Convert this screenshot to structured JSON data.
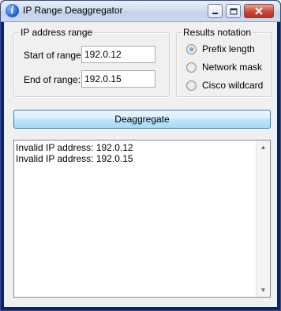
{
  "window": {
    "title": "IP Range Deaggregator",
    "icon": "info-icon"
  },
  "range_group": {
    "legend": "IP address range",
    "start_label": "Start of range:",
    "start_value": "192.0.12",
    "end_label": "End of range:",
    "end_value": "192.0.15"
  },
  "notation_group": {
    "legend": "Results notation",
    "options": [
      {
        "label": "Prefix length",
        "checked": true
      },
      {
        "label": "Network mask",
        "checked": false
      },
      {
        "label": "Cisco wildcard",
        "checked": false
      }
    ]
  },
  "action": {
    "button_label": "Deaggregate"
  },
  "output": {
    "lines": [
      "Invalid IP address: 192.0.12",
      "Invalid IP address: 192.0.15"
    ]
  },
  "colors": {
    "button_border": "#3c7fb1",
    "radio_selected": "#1a6bc4"
  }
}
